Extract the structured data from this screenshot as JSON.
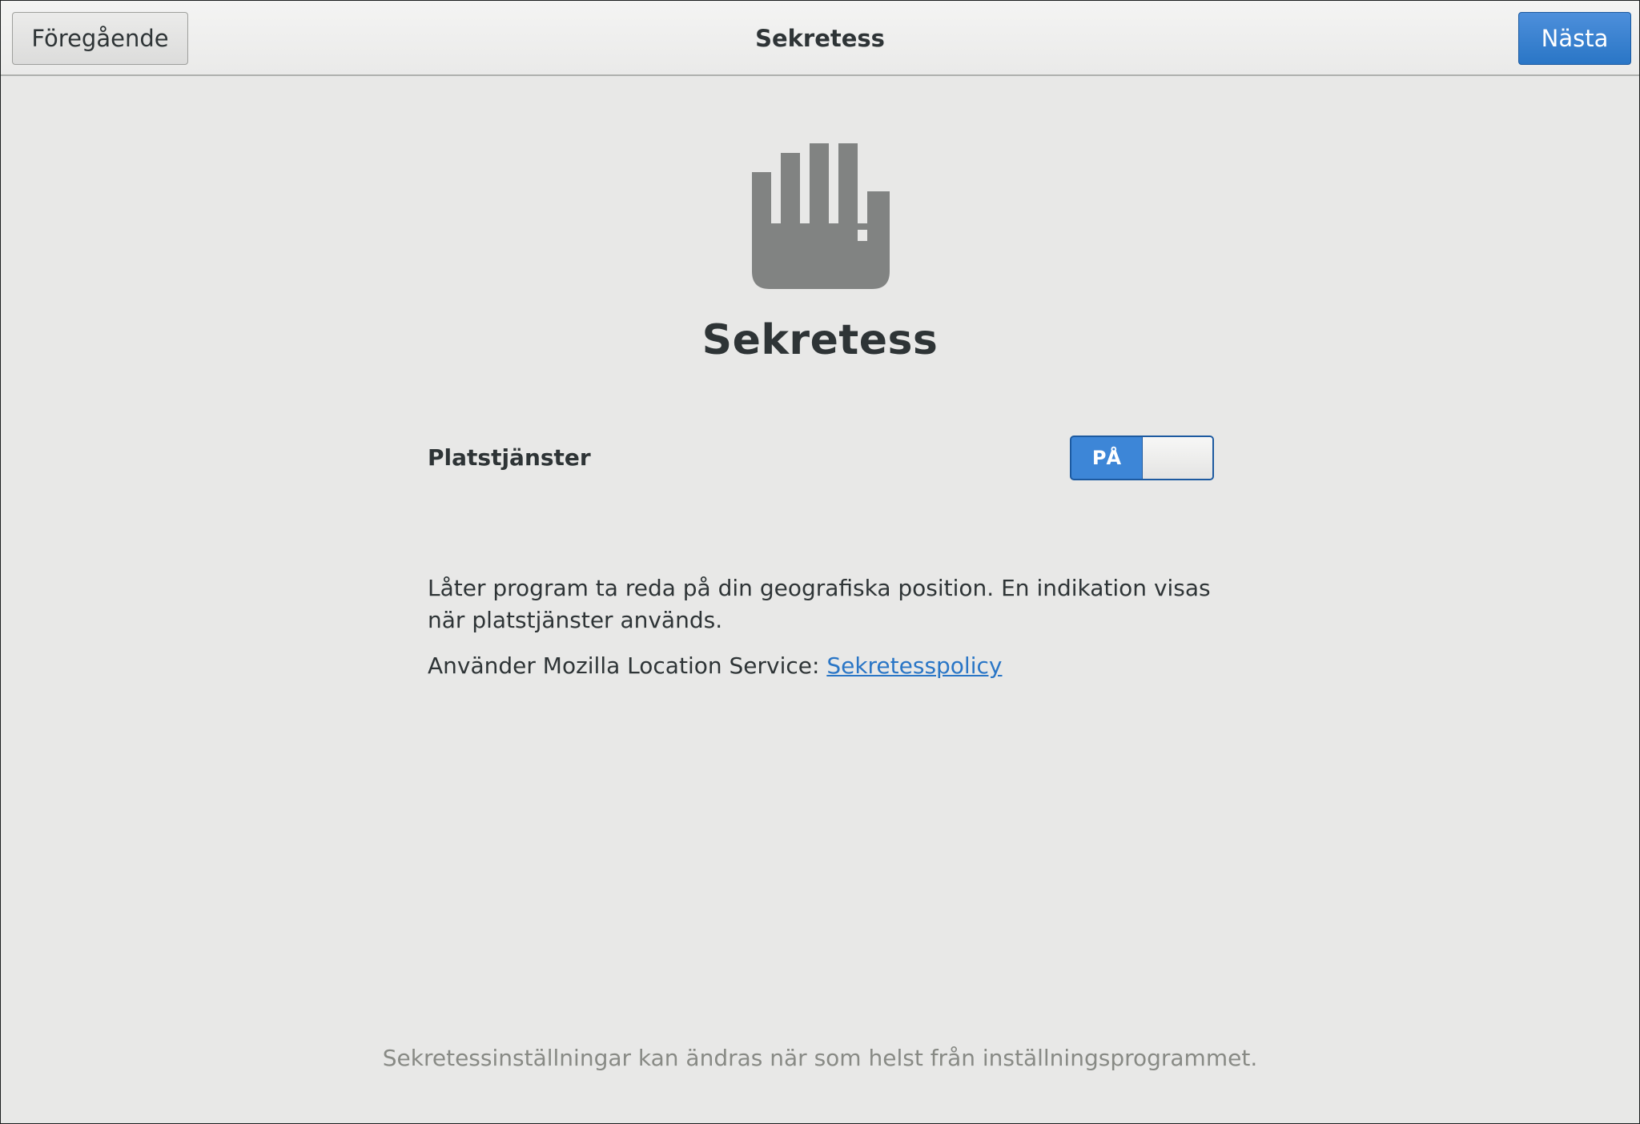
{
  "header": {
    "title": "Sekretess",
    "prev_label": "Föregående",
    "next_label": "Nästa"
  },
  "main": {
    "icon": "hand-privacy-icon",
    "title": "Sekretess",
    "location": {
      "label": "Platstjänster",
      "toggle_state": "PÅ",
      "description": "Låter program ta reda på din geografiska position. En indikation visas när platstjänster används.",
      "provider_text": "Använder Mozilla Location Service: ",
      "policy_link": "Sekretesspolicy"
    },
    "footer": "Sekretessinställningar kan ändras när som helst från inställningsprogrammet."
  },
  "colors": {
    "accent": "#2a76c6",
    "background": "#e8e8e7",
    "icon": "#818382"
  }
}
